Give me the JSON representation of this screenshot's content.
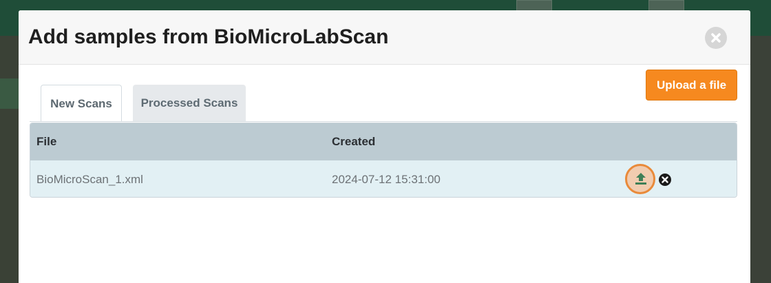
{
  "modal": {
    "title": "Add samples from BioMicroLabScan",
    "upload_label": "Upload a file"
  },
  "tabs": [
    {
      "label": "New Scans",
      "active": true
    },
    {
      "label": "Processed Scans",
      "active": false
    }
  ],
  "table": {
    "columns": [
      "File",
      "Created"
    ],
    "rows": [
      {
        "file": "BioMicroScan_1.xml",
        "created": "2024-07-12 15:31:00"
      }
    ]
  },
  "icons": {
    "close": "close-circle-icon",
    "row_upload": "upload-icon",
    "row_remove": "remove-circle-icon"
  },
  "colors": {
    "accent": "#f6891f",
    "table_header": "#bccbd2",
    "row_highlight": "#e2f0f4",
    "upload_icon": "#3f7f57"
  }
}
